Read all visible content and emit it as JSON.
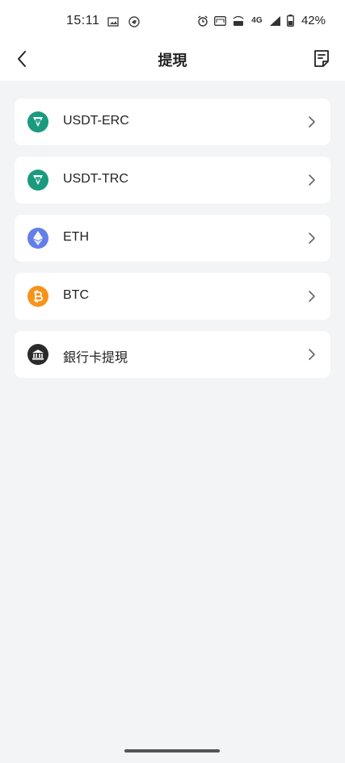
{
  "status_bar": {
    "time": "15:11",
    "battery": "42%",
    "network": "4G"
  },
  "header": {
    "title": "提現"
  },
  "methods": [
    {
      "label": "USDT-ERC",
      "icon": "tether-icon",
      "color": "#1a9a7e"
    },
    {
      "label": "USDT-TRC",
      "icon": "tether-icon",
      "color": "#1a9a7e"
    },
    {
      "label": "ETH",
      "icon": "ethereum-icon",
      "color": "#627eea"
    },
    {
      "label": "BTC",
      "icon": "bitcoin-icon",
      "color": "#f7931a"
    },
    {
      "label": "銀行卡提現",
      "icon": "bank-icon",
      "color": "#2b2b2b"
    }
  ]
}
